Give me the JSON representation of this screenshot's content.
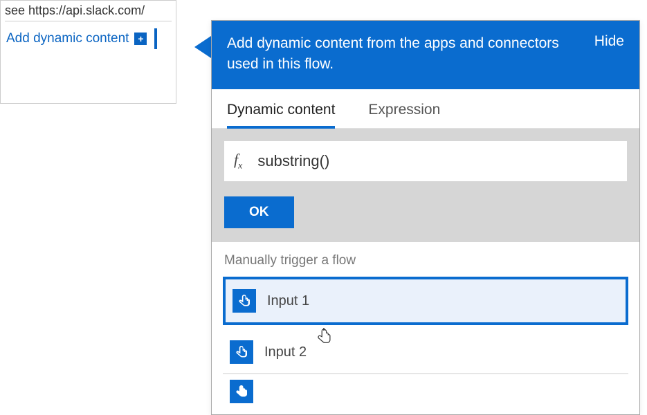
{
  "left": {
    "url_fragment": "see https://api.slack.com/",
    "add_dynamic": "Add dynamic content"
  },
  "popup": {
    "header_text": "Add dynamic content from the apps and connectors used in this flow.",
    "hide": "Hide",
    "tabs": {
      "dynamic": "Dynamic content",
      "expression": "Expression"
    },
    "expression": {
      "fx": "fx",
      "value": "substring()"
    },
    "ok": "OK",
    "section": "Manually trigger a flow",
    "items": [
      {
        "label": "Input 1"
      },
      {
        "label": "Input 2"
      }
    ]
  }
}
